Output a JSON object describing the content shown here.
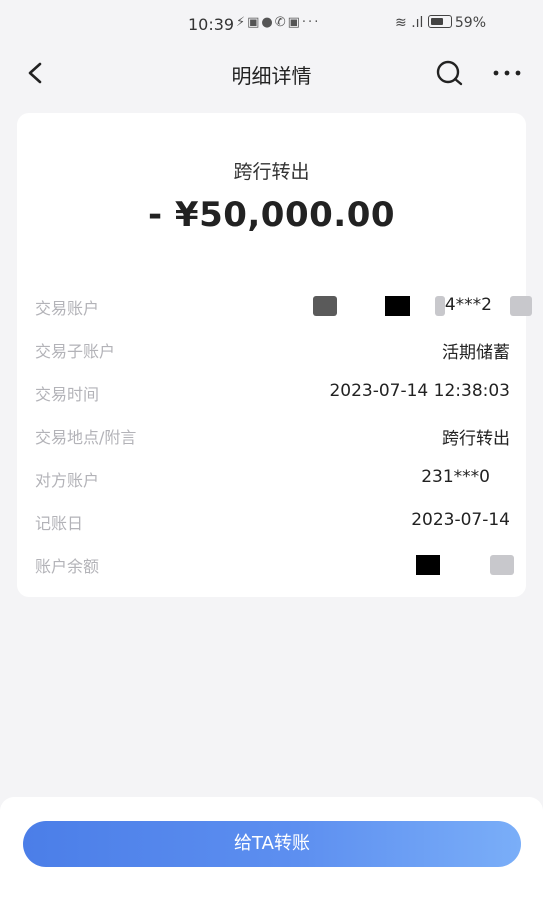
{
  "status_bar": {
    "time": "10:39",
    "battery": "59%"
  },
  "nav": {
    "title": "明细详情"
  },
  "transaction": {
    "type": "跨行转出",
    "amount": "- ¥50,000.00",
    "rows": [
      {
        "label": "交易账户",
        "value": "4***2"
      },
      {
        "label": "交易子账户",
        "value": "活期储蓄"
      },
      {
        "label": "交易时间",
        "value": "2023-07-14 12:38:03"
      },
      {
        "label": "交易地点/附言",
        "value": "跨行转出"
      },
      {
        "label": "对方账户",
        "value": "231***0"
      },
      {
        "label": "记账日",
        "value": "2023-07-14"
      },
      {
        "label": "账户余额",
        "value": ""
      }
    ]
  },
  "actions": {
    "transfer_label": "给TA转账"
  },
  "colors": {
    "accent": "#4b7ee8",
    "label": "#b3b3b8",
    "background": "#f4f4f6"
  }
}
